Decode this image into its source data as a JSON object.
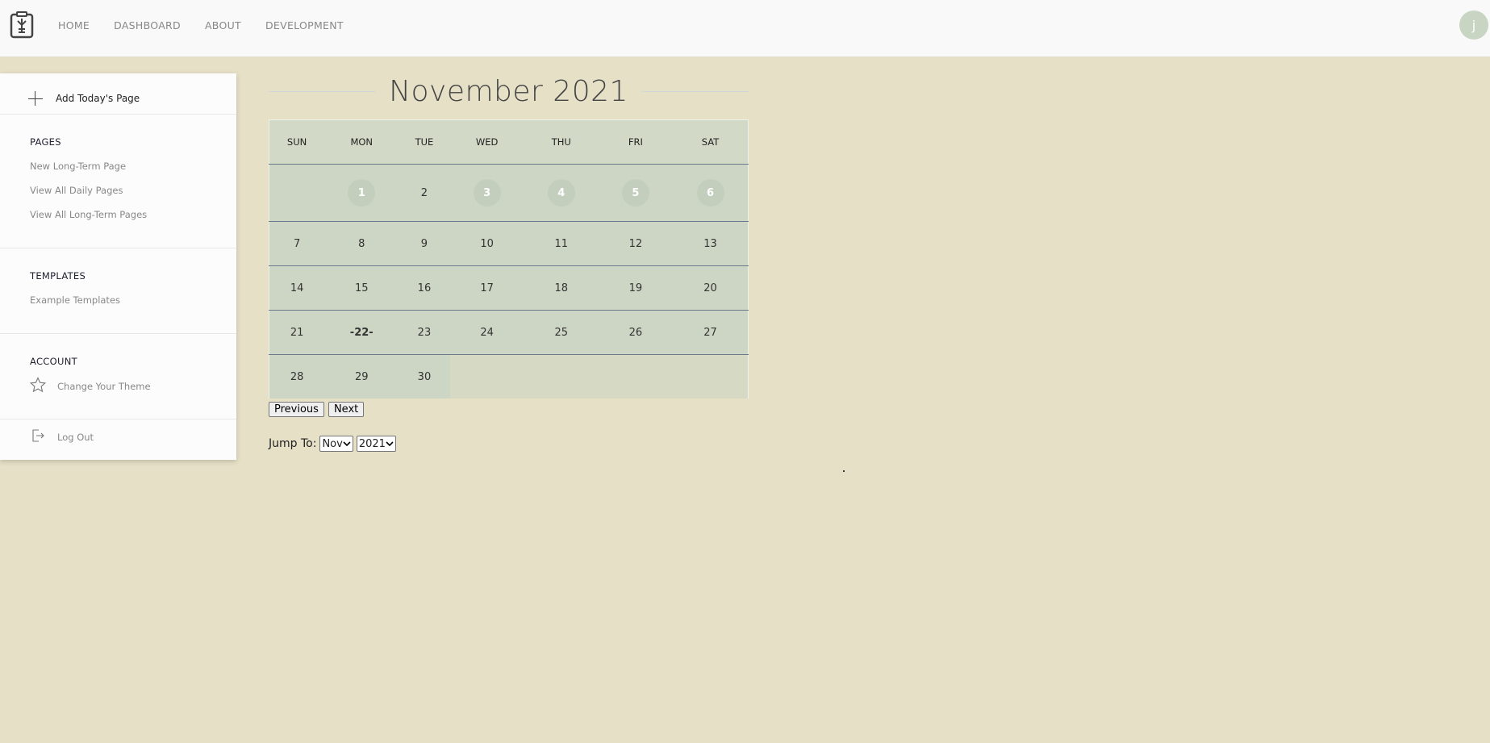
{
  "nav": {
    "items": [
      "HOME",
      "DASHBOARD",
      "ABOUT",
      "DEVELOPMENT"
    ],
    "avatar_initial": "j"
  },
  "sidebar": {
    "add_label": "Add Today's Page",
    "pages_heading": "PAGES",
    "pages_links": [
      "New Long-Term Page",
      "View All Daily Pages",
      "View All Long-Term Pages"
    ],
    "templates_heading": "TEMPLATES",
    "templates_links": [
      "Example Templates"
    ],
    "account_heading": "ACCOUNT",
    "theme_label": "Change Your Theme",
    "logout_label": "Log Out"
  },
  "calendar": {
    "title": "November 2021",
    "weekdays": [
      "SUN",
      "MON",
      "TUE",
      "WED",
      "THU",
      "FRI",
      "SAT"
    ],
    "weeks": [
      [
        "",
        "1",
        "2",
        "3",
        "4",
        "5",
        "6"
      ],
      [
        "7",
        "8",
        "9",
        "10",
        "11",
        "12",
        "13"
      ],
      [
        "14",
        "15",
        "16",
        "17",
        "18",
        "19",
        "20"
      ],
      [
        "21",
        "-22-",
        "23",
        "24",
        "25",
        "26",
        "27"
      ],
      [
        "28",
        "29",
        "30",
        "",
        "",
        "",
        ""
      ]
    ],
    "highlighted_days": [
      "1",
      "3",
      "4",
      "5",
      "6"
    ],
    "today": "-22-"
  },
  "controls": {
    "previous_label": "Previous",
    "next_label": "Next",
    "jump_label": "Jump To:",
    "month_selected": "Nov",
    "year_selected": "2021"
  },
  "colors": {
    "background": "#e6e0c7",
    "calendar_bg": "#cdd6c4",
    "bubble": "#c3cfbc"
  }
}
